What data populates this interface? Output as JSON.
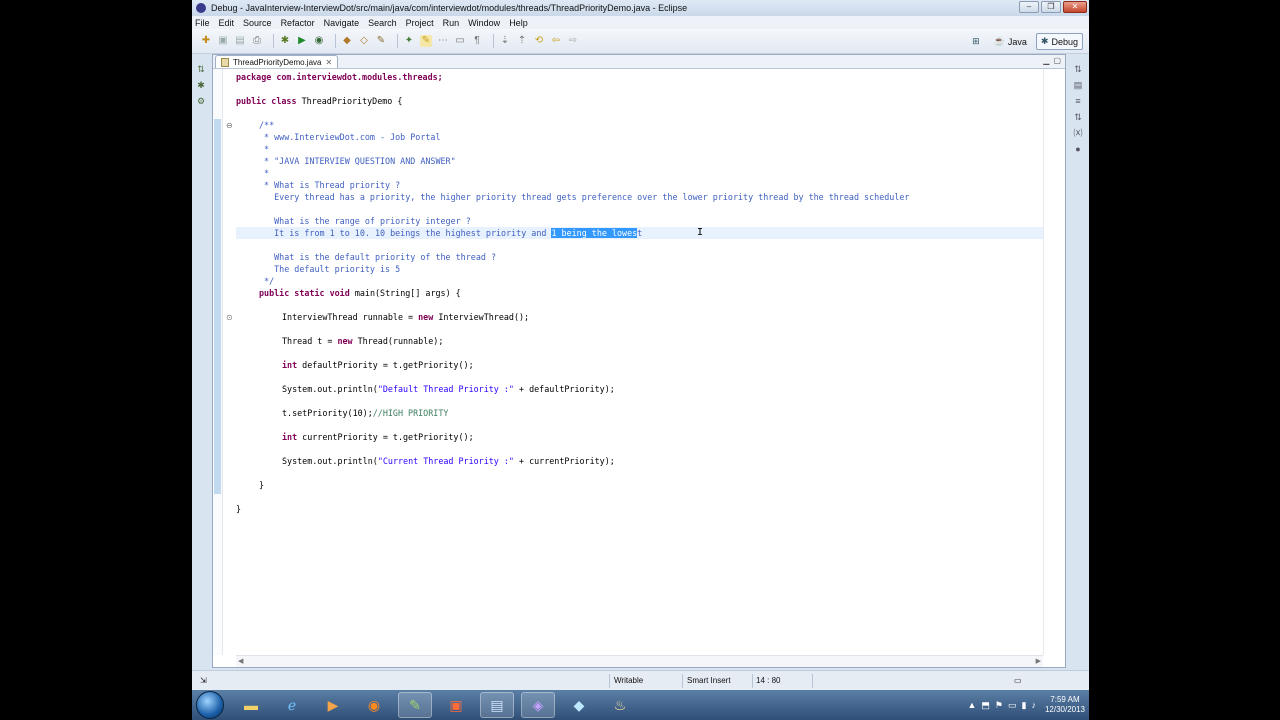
{
  "window": {
    "title": "Debug - JavaInterview-InterviewDot/src/main/java/com/interviewdot/modules/threads/ThreadPriorityDemo.java - Eclipse",
    "controls": [
      "–",
      "❐",
      "✕"
    ]
  },
  "menu": [
    "File",
    "Edit",
    "Source",
    "Refactor",
    "Navigate",
    "Search",
    "Project",
    "Run",
    "Window",
    "Help"
  ],
  "perspectives": {
    "java": "Java",
    "debug": "Debug"
  },
  "editor": {
    "tab_label": "ThreadPriorityDemo.java",
    "tab_close": "✕",
    "lines": {
      "l1": "package com.interviewdot.modules.threads;",
      "l3a": "public class ",
      "l3b": "ThreadPriorityDemo {",
      "l5": "/**",
      "l6": " * www.InterviewDot.com - Job Portal",
      "l7": " *",
      "l8": " * \"JAVA INTERVIEW QUESTION AND ANSWER\"",
      "l9": " *",
      "l10": " * What is Thread priority ?",
      "l11": "   Every thread has a priority, the higher priority thread gets preference over the lower priority thread by the thread scheduler",
      "l13": "   What is the range of priority integer ?",
      "l14a": "   It is from 1 to 10. 10 beings the highest priority and ",
      "l14b": "1 being the lowes",
      "l14c": "t",
      "l16": "   What is the default priority of the thread ?",
      "l17": "   The default priority is 5",
      "l18": " */",
      "l19a": "public static void ",
      "l19b": "main(String[] args) {",
      "l21a": "InterviewThread runnable = ",
      "l21b": "new ",
      "l21c": "InterviewThread();",
      "l23a": "Thread t = ",
      "l23b": "new ",
      "l23c": "Thread(runnable);",
      "l25a": "int ",
      "l25b": "defaultPriority = t.getPriority();",
      "l27a": "System.out.println(",
      "l27b": "\"Default Thread Priority :\"",
      "l27c": " + defaultPriority);",
      "l29a": "t.setPriority(10);",
      "l29b": "//HIGH PRIORITY",
      "l31a": "int ",
      "l31b": "currentPriority = t.getPriority();",
      "l33a": "System.out.println(",
      "l33b": "\"Current Thread Priority :\"",
      "l33c": " + currentPriority);",
      "l35": "}",
      "l37": "}"
    }
  },
  "status": {
    "writable": "Writable",
    "insert_mode": "Smart Insert",
    "position": "14 : 80"
  },
  "clock": {
    "time": "7:59 AM",
    "date": "12/30/2013"
  }
}
